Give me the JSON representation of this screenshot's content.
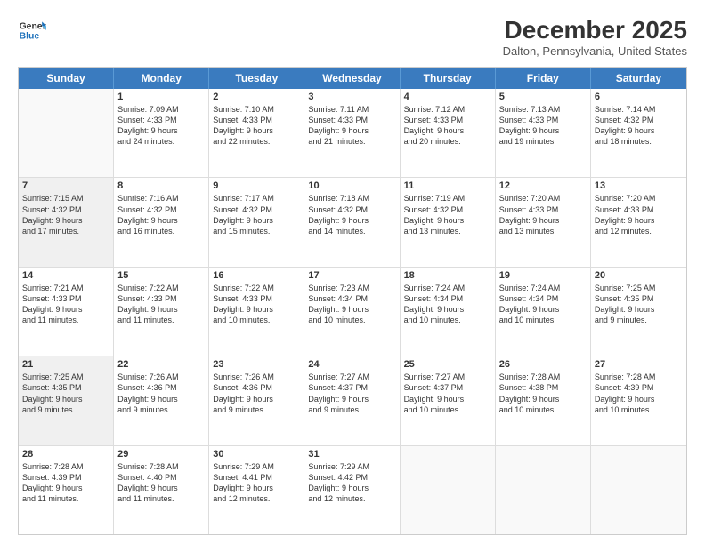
{
  "header": {
    "logo_line1": "General",
    "logo_line2": "Blue",
    "main_title": "December 2025",
    "sub_title": "Dalton, Pennsylvania, United States"
  },
  "days_of_week": [
    "Sunday",
    "Monday",
    "Tuesday",
    "Wednesday",
    "Thursday",
    "Friday",
    "Saturday"
  ],
  "weeks": [
    [
      {
        "day": "",
        "text": "",
        "empty": true
      },
      {
        "day": "1",
        "text": "Sunrise: 7:09 AM\nSunset: 4:33 PM\nDaylight: 9 hours\nand 24 minutes."
      },
      {
        "day": "2",
        "text": "Sunrise: 7:10 AM\nSunset: 4:33 PM\nDaylight: 9 hours\nand 22 minutes."
      },
      {
        "day": "3",
        "text": "Sunrise: 7:11 AM\nSunset: 4:33 PM\nDaylight: 9 hours\nand 21 minutes."
      },
      {
        "day": "4",
        "text": "Sunrise: 7:12 AM\nSunset: 4:33 PM\nDaylight: 9 hours\nand 20 minutes."
      },
      {
        "day": "5",
        "text": "Sunrise: 7:13 AM\nSunset: 4:33 PM\nDaylight: 9 hours\nand 19 minutes."
      },
      {
        "day": "6",
        "text": "Sunrise: 7:14 AM\nSunset: 4:32 PM\nDaylight: 9 hours\nand 18 minutes."
      }
    ],
    [
      {
        "day": "7",
        "text": "Sunrise: 7:15 AM\nSunset: 4:32 PM\nDaylight: 9 hours\nand 17 minutes.",
        "shaded": true
      },
      {
        "day": "8",
        "text": "Sunrise: 7:16 AM\nSunset: 4:32 PM\nDaylight: 9 hours\nand 16 minutes."
      },
      {
        "day": "9",
        "text": "Sunrise: 7:17 AM\nSunset: 4:32 PM\nDaylight: 9 hours\nand 15 minutes."
      },
      {
        "day": "10",
        "text": "Sunrise: 7:18 AM\nSunset: 4:32 PM\nDaylight: 9 hours\nand 14 minutes."
      },
      {
        "day": "11",
        "text": "Sunrise: 7:19 AM\nSunset: 4:32 PM\nDaylight: 9 hours\nand 13 minutes."
      },
      {
        "day": "12",
        "text": "Sunrise: 7:20 AM\nSunset: 4:33 PM\nDaylight: 9 hours\nand 13 minutes."
      },
      {
        "day": "13",
        "text": "Sunrise: 7:20 AM\nSunset: 4:33 PM\nDaylight: 9 hours\nand 12 minutes."
      }
    ],
    [
      {
        "day": "14",
        "text": "Sunrise: 7:21 AM\nSunset: 4:33 PM\nDaylight: 9 hours\nand 11 minutes."
      },
      {
        "day": "15",
        "text": "Sunrise: 7:22 AM\nSunset: 4:33 PM\nDaylight: 9 hours\nand 11 minutes."
      },
      {
        "day": "16",
        "text": "Sunrise: 7:22 AM\nSunset: 4:33 PM\nDaylight: 9 hours\nand 10 minutes."
      },
      {
        "day": "17",
        "text": "Sunrise: 7:23 AM\nSunset: 4:34 PM\nDaylight: 9 hours\nand 10 minutes."
      },
      {
        "day": "18",
        "text": "Sunrise: 7:24 AM\nSunset: 4:34 PM\nDaylight: 9 hours\nand 10 minutes."
      },
      {
        "day": "19",
        "text": "Sunrise: 7:24 AM\nSunset: 4:34 PM\nDaylight: 9 hours\nand 10 minutes."
      },
      {
        "day": "20",
        "text": "Sunrise: 7:25 AM\nSunset: 4:35 PM\nDaylight: 9 hours\nand 9 minutes."
      }
    ],
    [
      {
        "day": "21",
        "text": "Sunrise: 7:25 AM\nSunset: 4:35 PM\nDaylight: 9 hours\nand 9 minutes.",
        "shaded": true
      },
      {
        "day": "22",
        "text": "Sunrise: 7:26 AM\nSunset: 4:36 PM\nDaylight: 9 hours\nand 9 minutes."
      },
      {
        "day": "23",
        "text": "Sunrise: 7:26 AM\nSunset: 4:36 PM\nDaylight: 9 hours\nand 9 minutes."
      },
      {
        "day": "24",
        "text": "Sunrise: 7:27 AM\nSunset: 4:37 PM\nDaylight: 9 hours\nand 9 minutes."
      },
      {
        "day": "25",
        "text": "Sunrise: 7:27 AM\nSunset: 4:37 PM\nDaylight: 9 hours\nand 10 minutes."
      },
      {
        "day": "26",
        "text": "Sunrise: 7:28 AM\nSunset: 4:38 PM\nDaylight: 9 hours\nand 10 minutes."
      },
      {
        "day": "27",
        "text": "Sunrise: 7:28 AM\nSunset: 4:39 PM\nDaylight: 9 hours\nand 10 minutes."
      }
    ],
    [
      {
        "day": "28",
        "text": "Sunrise: 7:28 AM\nSunset: 4:39 PM\nDaylight: 9 hours\nand 11 minutes."
      },
      {
        "day": "29",
        "text": "Sunrise: 7:28 AM\nSunset: 4:40 PM\nDaylight: 9 hours\nand 11 minutes."
      },
      {
        "day": "30",
        "text": "Sunrise: 7:29 AM\nSunset: 4:41 PM\nDaylight: 9 hours\nand 12 minutes."
      },
      {
        "day": "31",
        "text": "Sunrise: 7:29 AM\nSunset: 4:42 PM\nDaylight: 9 hours\nand 12 minutes."
      },
      {
        "day": "",
        "text": "",
        "empty": true
      },
      {
        "day": "",
        "text": "",
        "empty": true
      },
      {
        "day": "",
        "text": "",
        "empty": true
      }
    ]
  ]
}
